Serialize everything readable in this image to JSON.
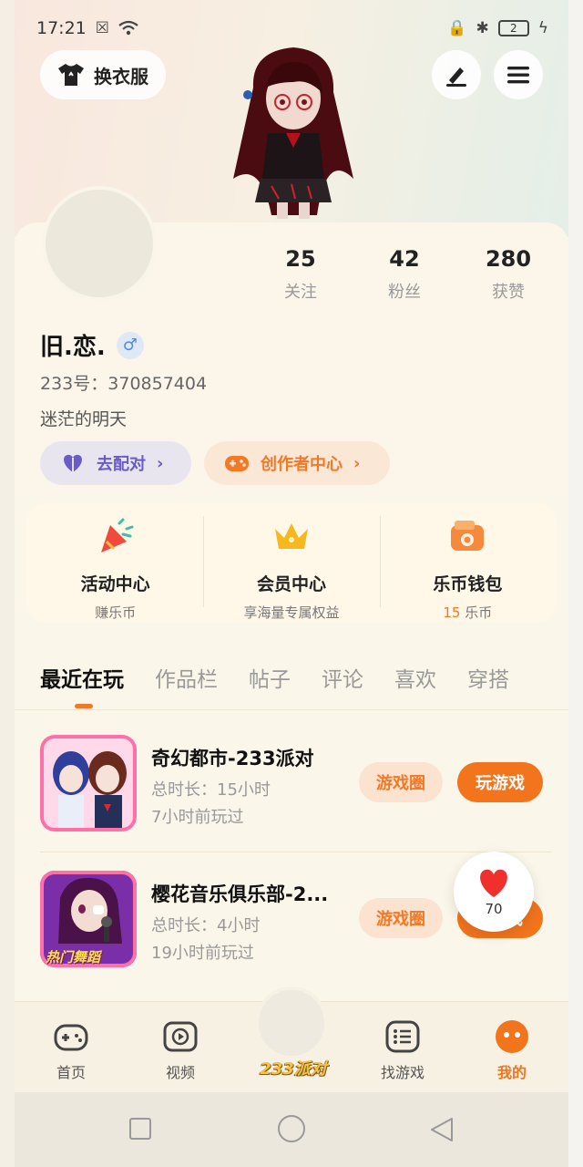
{
  "status_bar": {
    "time": "17:21",
    "battery": "2"
  },
  "header": {
    "outfit_button": "换衣服",
    "edit_icon": "pen-icon",
    "menu_icon": "hamburger-menu-icon"
  },
  "profile": {
    "stats": [
      {
        "value": "25",
        "label": "关注"
      },
      {
        "value": "42",
        "label": "粉丝"
      },
      {
        "value": "280",
        "label": "获赞"
      }
    ],
    "name": "旧.恋.",
    "gender_symbol": "♂",
    "uid": "233号：370857404",
    "bio": "迷茫的明天",
    "match_button": "去配对",
    "creator_button": "创作者中心"
  },
  "services": [
    {
      "title": "活动中心",
      "subtitle": "赚乐币"
    },
    {
      "title": "会员中心",
      "subtitle": "享海量专属权益"
    },
    {
      "title": "乐币钱包",
      "amount": "15",
      "unit": " 乐币"
    }
  ],
  "tabs": [
    "最近在玩",
    "作品栏",
    "帖子",
    "评论",
    "喜欢",
    "穿搭"
  ],
  "active_tab": "最近在玩",
  "games": [
    {
      "title": "奇幻都市-233派对",
      "duration": "总时长：15小时",
      "last_played": "7小时前玩过",
      "circle_btn": "游戏圈",
      "play_btn": "玩游戏"
    },
    {
      "title": "樱花音乐俱乐部-2...",
      "duration": "总时长：4小时",
      "last_played": "19小时前玩过",
      "circle_btn": "游戏圈",
      "play_btn": "戏",
      "icon_caption": "热门舞蹈"
    }
  ],
  "like_float": {
    "count": "70"
  },
  "bottom_nav": [
    {
      "label": "首页"
    },
    {
      "label": "视频"
    },
    {
      "label": "233派对"
    },
    {
      "label": "找游戏"
    },
    {
      "label": "我的"
    }
  ],
  "colors": {
    "accent": "#f2741c",
    "match": "#6a5bc9",
    "background": "#fbf6ea"
  }
}
